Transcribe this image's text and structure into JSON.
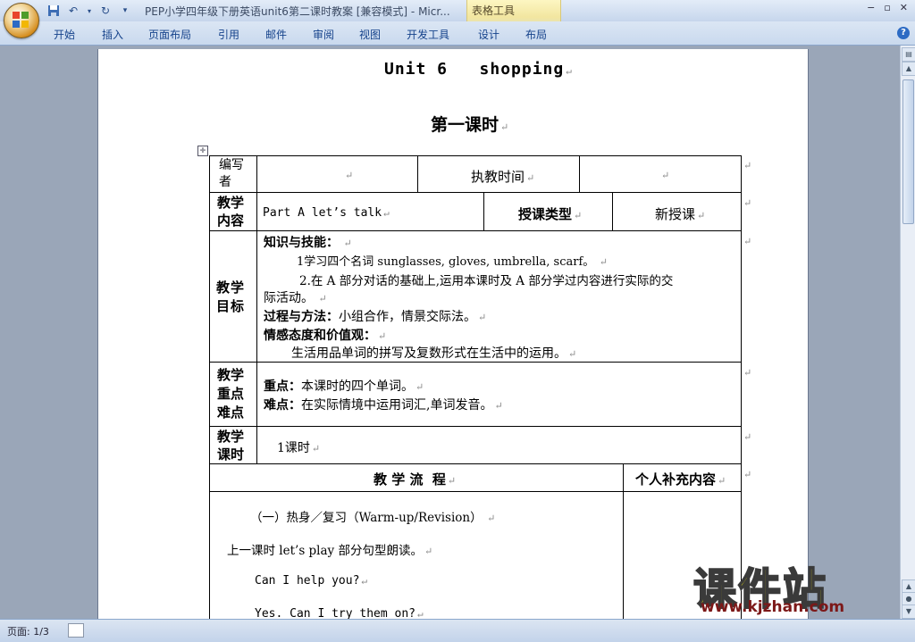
{
  "window": {
    "title": "PEP小学四年级下册英语unit6第二课时教案 [兼容模式] - Micr...",
    "context_group": "表格工具",
    "controls": [
      "−",
      "▫",
      "✕"
    ]
  },
  "ribbon": {
    "tabs": [
      "开始",
      "插入",
      "页面布局",
      "引用",
      "邮件",
      "审阅",
      "视图",
      "开发工具",
      "设计",
      "布局"
    ]
  },
  "document": {
    "unit_title": "Unit 6   shopping",
    "lesson_title": "第一课时",
    "table": {
      "author_label": "编写者",
      "author_value": "",
      "time_label": "执教时间",
      "time_value": "",
      "content_label": "教学内容",
      "content_value": "Part A   let’s talk",
      "type_label": "授课类型",
      "type_value": "新授课",
      "goals_label": "教学目标",
      "goals": {
        "knowledge_heading": "知识与技能：",
        "knowledge_1": "1学习四个名词 sunglasses,  gloves,  umbrella,  scarf。",
        "knowledge_2a": "2.在 A 部分对话的基础上,运用本课时及 A 部分学过内容进行实际的交",
        "knowledge_2b": "际活动。",
        "process_heading": "过程与方法：",
        "process_text": "小组合作，情景交际法。",
        "attitude_heading": "情感态度和价值观：",
        "attitude_text": "生活用品单词的拼写及复数形式在生活中的运用。"
      },
      "keypoints_label": "教学重点难点",
      "key_heading": "重点：",
      "key_text": "本课时的四个单词。",
      "difficulty_heading": "难点：",
      "difficulty_text": "在实际情境中运用词汇,单词发音。",
      "hours_label": "教学课时",
      "hours_value": "1课时",
      "flow_header": "教 学 流  程",
      "supplement_header": "个人补充内容",
      "flow": {
        "step1": "（一）热身／复习（Warm-up/Revision）",
        "step1_text": "上一课时 let’s play 部分句型朗读。",
        "line_1": "Can I help you?",
        "line_2": "Yes. Can I try them on?"
      }
    }
  },
  "status_bar": {
    "page": "页面: 1/3"
  },
  "watermark": {
    "cn": "课件站",
    "url": "www.kjzhan.com"
  }
}
